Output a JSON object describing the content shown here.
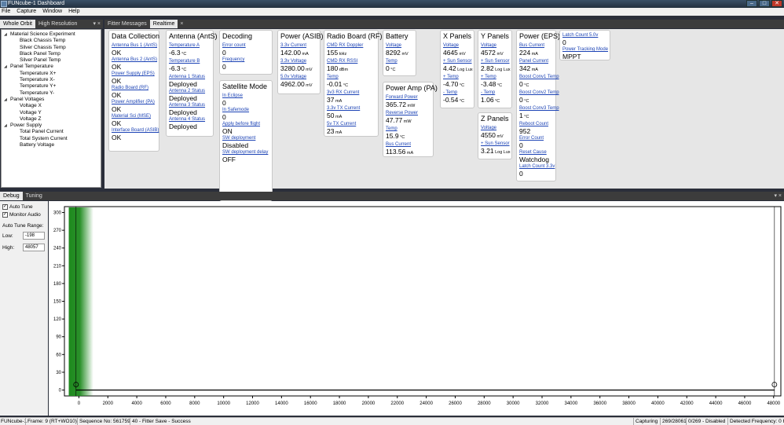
{
  "window": {
    "title": "FUNcube-1 Dashboard"
  },
  "menu": [
    "File",
    "Capture",
    "Window",
    "Help"
  ],
  "left_pane": {
    "tabs": [
      "Whole Orbit",
      "High Resolution"
    ],
    "tree": [
      {
        "label": "Material Science Experiment",
        "level": 1
      },
      {
        "label": "Black Chassis Temp",
        "level": 2
      },
      {
        "label": "Silver Chassis Temp",
        "level": 2
      },
      {
        "label": "Black Panel Temp",
        "level": 2
      },
      {
        "label": "Silver Panel Temp",
        "level": 2
      },
      {
        "label": "Panel Temperature",
        "level": 1
      },
      {
        "label": "Temperature X+",
        "level": 2
      },
      {
        "label": "Temperature X-",
        "level": 2
      },
      {
        "label": "Temperature Y+",
        "level": 2
      },
      {
        "label": "Temperature Y-",
        "level": 2
      },
      {
        "label": "Panel Voltages",
        "level": 1
      },
      {
        "label": "Voltage X",
        "level": 2
      },
      {
        "label": "Voltage Y",
        "level": 2
      },
      {
        "label": "Voltage Z",
        "level": 2
      },
      {
        "label": "Power Supply",
        "level": 1
      },
      {
        "label": "Total Panel Current",
        "level": 2
      },
      {
        "label": "Total System Current",
        "level": 2
      },
      {
        "label": "Battery Voltage",
        "level": 2
      }
    ]
  },
  "right_pane": {
    "tabs": [
      "Fitter Messages",
      "Realtime"
    ]
  },
  "modules": [
    {
      "title": "Data Collection",
      "items": [
        {
          "label": "Antenna Bus 1 (AntS)",
          "value": "OK"
        },
        {
          "label": "Antenna Bus 2 (AntS)",
          "value": "OK"
        },
        {
          "label": "Power Supply (EPS)",
          "value": "OK"
        },
        {
          "label": "Radio Board (RF)",
          "value": "OK"
        },
        {
          "label": "Power Amplifier (PA)",
          "value": "OK"
        },
        {
          "label": "Material Sci (MSE)",
          "value": "OK"
        },
        {
          "label": "Interface Board (ASIB)",
          "value": "OK"
        }
      ]
    },
    {
      "title": "Antenna (AntS)",
      "items": [
        {
          "label": "Temperature A",
          "value": "-6.3",
          "unit": "°C"
        },
        {
          "label": "Temperature B",
          "value": "-6.3",
          "unit": "°C"
        },
        {
          "label": "Antenna 1 Status",
          "value": "Deployed"
        },
        {
          "label": "Antenna 2 Status",
          "value": "Deployed"
        },
        {
          "label": "Antenna 3 Status",
          "value": "Deployed"
        },
        {
          "label": "Antenna 4 Status",
          "value": "Deployed"
        }
      ]
    },
    {
      "title": "Decoding",
      "items": [
        {
          "label": "Error count",
          "value": "0"
        },
        {
          "label": "Frequency",
          "value": "0"
        }
      ]
    },
    {
      "title": "Satellite Mode",
      "items": [
        {
          "label": "In Eclipse",
          "value": "0"
        },
        {
          "label": "In Safemode",
          "value": "0"
        },
        {
          "label": "Apply before flight",
          "value": "ON"
        },
        {
          "label": "SW deployment",
          "value": "Disabled"
        },
        {
          "label": "SW deployment delay",
          "value": "OFF"
        }
      ]
    },
    {
      "title": "Power (ASIB)",
      "items": [
        {
          "label": "3.3v Current",
          "value": "142.00",
          "unit": "mA"
        },
        {
          "label": "3.3v Voltage",
          "value": "3280.00",
          "unit": "mV"
        },
        {
          "label": "5.0v Voltage",
          "value": "4962.00",
          "unit": "mV"
        }
      ]
    },
    {
      "title": "Radio Board (RF)",
      "items": [
        {
          "label": "CMD RX Doppler",
          "value": "155",
          "unit": "kHz"
        },
        {
          "label": "CMD RX RSSI",
          "value": "180",
          "unit": "dBm"
        },
        {
          "label": "Temp",
          "value": "-0.01",
          "unit": "°C"
        },
        {
          "label": "3v3 RX Current",
          "value": "37",
          "unit": "mA"
        },
        {
          "label": "3.3v TX Current",
          "value": "50",
          "unit": "mA"
        },
        {
          "label": "5v TX Current",
          "value": "23",
          "unit": "mA"
        }
      ]
    },
    {
      "title": "Battery",
      "items": [
        {
          "label": "Voltage",
          "value": "8292",
          "unit": "mV"
        },
        {
          "label": "Temp",
          "value": "0",
          "unit": "°C"
        }
      ]
    },
    {
      "title": "Power Amp (PA)",
      "items": [
        {
          "label": "Forward Power",
          "value": "365.72",
          "unit": "mW"
        },
        {
          "label": "Reverse Power",
          "value": "47.77",
          "unit": "mW"
        },
        {
          "label": "Temp",
          "value": "15.9",
          "unit": "°C"
        },
        {
          "label": "Bus Current",
          "value": "113.56",
          "unit": "mA"
        }
      ]
    },
    {
      "title": "X Panels",
      "items": [
        {
          "label": "Voltage",
          "value": "4645",
          "unit": "mV"
        },
        {
          "label": "+ Sun Sensor",
          "value": "4.42",
          "unit": "Log Lux"
        },
        {
          "label": "+ Temp",
          "value": "-4.70",
          "unit": "°C"
        },
        {
          "label": "- Temp",
          "value": "-0.54",
          "unit": "°C"
        }
      ]
    },
    {
      "title": "Y Panels",
      "items": [
        {
          "label": "Voltage",
          "value": "4572",
          "unit": "mV"
        },
        {
          "label": "+ Sun Sensor",
          "value": "2.82",
          "unit": "Log Lux"
        },
        {
          "label": "+ Temp",
          "value": "-3.48",
          "unit": "°C"
        },
        {
          "label": "- Temp",
          "value": "1.06",
          "unit": "°C"
        }
      ]
    },
    {
      "title": "Z Panels",
      "items": [
        {
          "label": "Voltage",
          "value": "4550",
          "unit": "mV"
        },
        {
          "label": "+ Sun Sensor",
          "value": "3.21",
          "unit": "Log Lux"
        }
      ]
    },
    {
      "title": "Power (EPS)",
      "items": [
        {
          "label": "Bus Current",
          "value": "224",
          "unit": "mA"
        },
        {
          "label": "Panel Current",
          "value": "342",
          "unit": "mA"
        },
        {
          "label": "Boost Conv1 Temp",
          "value": "0",
          "unit": "°C"
        },
        {
          "label": "Boost Conv2 Temp",
          "value": "0",
          "unit": "°C"
        },
        {
          "label": "Boost Conv3 Temp",
          "value": "1",
          "unit": "°C"
        },
        {
          "label": "Reboot Count",
          "value": "952"
        },
        {
          "label": "Error Count",
          "value": "0"
        },
        {
          "label": "Reset Cause",
          "value": "Watchdog"
        },
        {
          "label": "Latch Count 3.3v",
          "value": "0"
        }
      ]
    },
    {
      "title": "",
      "items": [
        {
          "label": "Latch Count 5.0v",
          "value": "0"
        },
        {
          "label": "Power Tracking Mode",
          "value": "MPPT"
        }
      ]
    }
  ],
  "bottom_pane": {
    "tabs": [
      "Debug",
      "Tuning"
    ],
    "auto_tune_label": "Auto Tune",
    "monitor_audio_label": "Monitor Audio",
    "range_label": "Auto Tune Range:",
    "low_label": "Low:",
    "low_value": "-198",
    "high_label": "High:",
    "high_value": "48057"
  },
  "chart_data": {
    "type": "line",
    "title": "",
    "xlabel": "",
    "ylabel": "",
    "xlim": [
      -1000,
      48500
    ],
    "ylim": [
      -10,
      310
    ],
    "xticks": [
      0,
      2000,
      4000,
      6000,
      8000,
      10000,
      12000,
      14000,
      16000,
      18000,
      20000,
      22000,
      24000,
      26000,
      28000,
      30000,
      32000,
      34000,
      36000,
      38000,
      40000,
      42000,
      44000,
      46000,
      48000
    ],
    "yticks": [
      0,
      30,
      60,
      90,
      120,
      150,
      180,
      210,
      240,
      270,
      300
    ],
    "series": [
      {
        "x": [
          -198,
          48057
        ],
        "y": [
          0,
          0
        ]
      }
    ],
    "markers": [
      {
        "x": -198,
        "y": 0
      },
      {
        "x": 48057,
        "y": 0
      }
    ],
    "band": {
      "x0": -700,
      "x1": 1000,
      "color": "#1e8a1e"
    },
    "grid": false,
    "legend": "none"
  },
  "status": {
    "left": "FUNcube-1",
    "frame": "Frame: 9 (RT+WO10)",
    "sequence": "Sequence No: 561759",
    "message": "40 - Fitter Save - Success",
    "capturing": "Capturing",
    "count": "269/28061",
    "disabled": "0/269 - Disabled",
    "detected": "Detected Frequency: 0 H"
  }
}
